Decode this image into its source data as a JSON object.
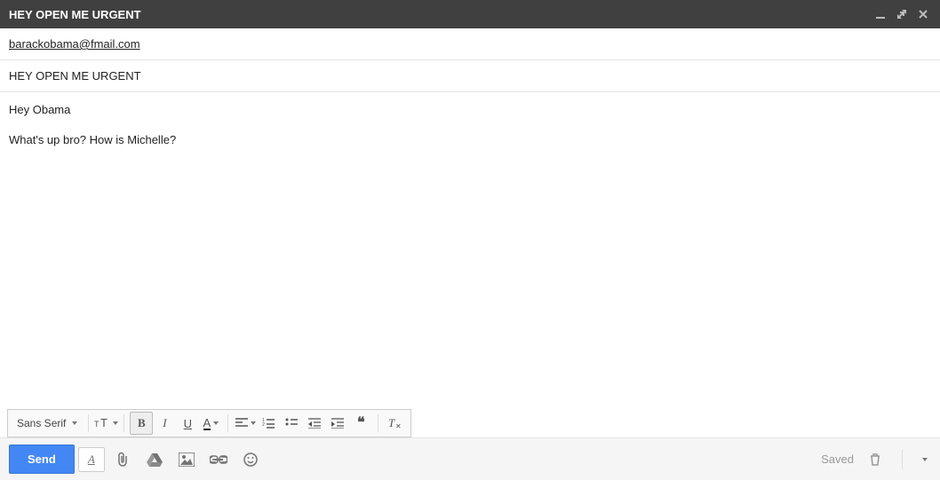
{
  "titlebar": {
    "title": "HEY OPEN ME URGENT"
  },
  "compose": {
    "recipient": "barackobama@fmail.com",
    "subject": "HEY OPEN ME URGENT",
    "body_line1": "Hey Obama",
    "body_line2": "What's up bro? How is Michelle?"
  },
  "format": {
    "font": "Sans Serif"
  },
  "bottom": {
    "send": "Send",
    "status": "Saved"
  }
}
